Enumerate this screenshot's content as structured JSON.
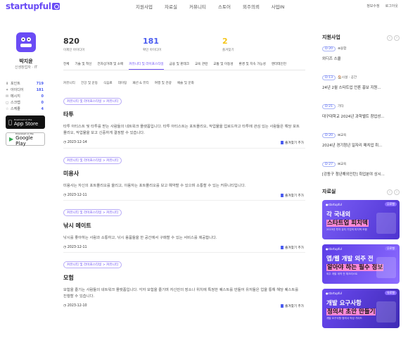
{
  "header": {
    "logo": "startupful",
    "nav": [
      "지원사업",
      "자료실",
      "커뮤니티",
      "스토어",
      "외주의뢰",
      "사업IN"
    ],
    "util": [
      "정보수정",
      "로그아웃"
    ]
  },
  "profile": {
    "name": "박지윤",
    "subtitle": "신생창업자 · IT",
    "stats": [
      {
        "icon": "download-icon",
        "glyph": "⬇",
        "label": "포인트",
        "value": "719"
      },
      {
        "icon": "idea-icon",
        "glyph": "✦",
        "label": "아이디어",
        "value": "181"
      },
      {
        "icon": "message-icon",
        "glyph": "✉",
        "label": "메시지",
        "value": "0"
      },
      {
        "icon": "scrap-icon",
        "glyph": "◻",
        "label": "스크랩",
        "value": "0"
      },
      {
        "icon": "star-icon",
        "glyph": "☆",
        "label": "스케줄",
        "value": "4"
      }
    ],
    "appstore": {
      "small": "Download on the",
      "big": "App Store"
    },
    "googleplay": {
      "small": "Download on the",
      "big": "Google Play"
    }
  },
  "counts": [
    {
      "num": "820",
      "label": "이제인 아이디어",
      "color": "#333333"
    },
    {
      "num": "181",
      "label": "확인 아이디어",
      "color": "#4a5cf0"
    },
    {
      "num": "2",
      "label": "즐겨찾기",
      "color": "#f5c518"
    }
  ],
  "tabs": [
    "전체",
    "기술 및 혁신",
    "전자상거래 및 소매",
    "커뮤니티 및 라이프스타일",
    "금융 및 핀테크",
    "교육 관련",
    "교통 및 이동성",
    "환경 및 지속 가능성",
    "엔터테인먼"
  ],
  "active_tab": "커뮤니티 및 라이프스타일",
  "subtabs": [
    "커뮤니티",
    "건강 및 운동",
    "식음료",
    "데이팅",
    "패션 & 뷰티",
    "여행 및 관광",
    "예술 및 문화"
  ],
  "cards": [
    {
      "badge": "커뮤니티 및 라이프스타일 > 커뮤니티",
      "title": "타투",
      "desc": "타투 아티스트 및 타투를 받는 사람들의 네트워크 플랫폼입니다. 타투 아티스트는 포트폴리오, 작업물을 업로드하고 타투에 관심 있는 사람들은 해당 포트폴리오, 작업물을 보고 신중하게 결정할 수 있습니다.",
      "date": "2023-12-14",
      "fav": "즐겨찾기 추가"
    },
    {
      "badge": "커뮤니티 및 라이프스타일 > 커뮤니티",
      "title": "미용사",
      "desc": "미용사는 자신의 포트폴리오를 올리고, 이용자는 포트폴리오를 보고 예약할 수 있으며 소통할 수 있는 커뮤니티입니다.",
      "date": "2023-12-11",
      "fav": "즐겨찾기 추가"
    },
    {
      "badge": "커뮤니티 및 라이프스타일 > 커뮤니티",
      "title": "낚시 메이트",
      "desc": "낚시를 좋아하는 사람과 소통하고, 낚시 용품들을 한 공간에서 구매할 수 있는 서비스를 제공합니다.",
      "date": "2023-12-11",
      "fav": "즐겨찾기 추가"
    },
    {
      "badge": "커뮤니티 및 라이프스타일 > 커뮤니티",
      "title": "모험",
      "desc": "모험을 즐기는 사람들의 네트워크 플랫폼입니다. 각자 모험을 즐기며 자신만의 장소나 위치에 특정한 퀘스트를 만들어 유저들은 업을 통해 해당 퀘스트를 진행할 수 있습니다.",
      "date": "2023-12-10",
      "fav": "즐겨찾기 추가"
    }
  ],
  "support": {
    "title": "지원사업",
    "items": [
      {
        "dday": "D-20",
        "cat": "⊕융합",
        "text": "외디즈 스쿨"
      },
      {
        "dday": "D-13",
        "cat": "🏠시설 · 공간",
        "text": "24년 2월 스타트업 언론 홍보 지원..."
      },
      {
        "dday": "D-21",
        "cat": "기타",
        "text": "대구대학교 2024년 과학벨트 창업성..."
      },
      {
        "dday": "D-20",
        "cat": "⊞교육",
        "text": "2024년 경기청년 일자리 매치업 취..."
      },
      {
        "dday": "D-27",
        "cat": "⊞교육",
        "text": "[강동구 청년해외인턴] 취업분야 상시..."
      }
    ]
  },
  "resources": {
    "title": "자료실",
    "banners": [
      {
        "brand": "●startupful",
        "tag": "무료형",
        "l1": "각 국내외",
        "l2": "스타트업 피치덱",
        "foot": "2023년 투자 유치 기업의 피치덱 모음"
      },
      {
        "brand": "●startupful",
        "tag": "무료형",
        "l1": "앱/웹 개발 외주 전",
        "l2": "알아야 하는 필수 정보",
        "foot": "외주 개발 계약 전 체크리스트"
      },
      {
        "brand": "●startupful",
        "tag": "유료형",
        "l1": "개발 요구사항",
        "l2": "정의서 초안 만들기",
        "foot": "개발 요구사항 정의서 작성 가이드"
      }
    ]
  }
}
